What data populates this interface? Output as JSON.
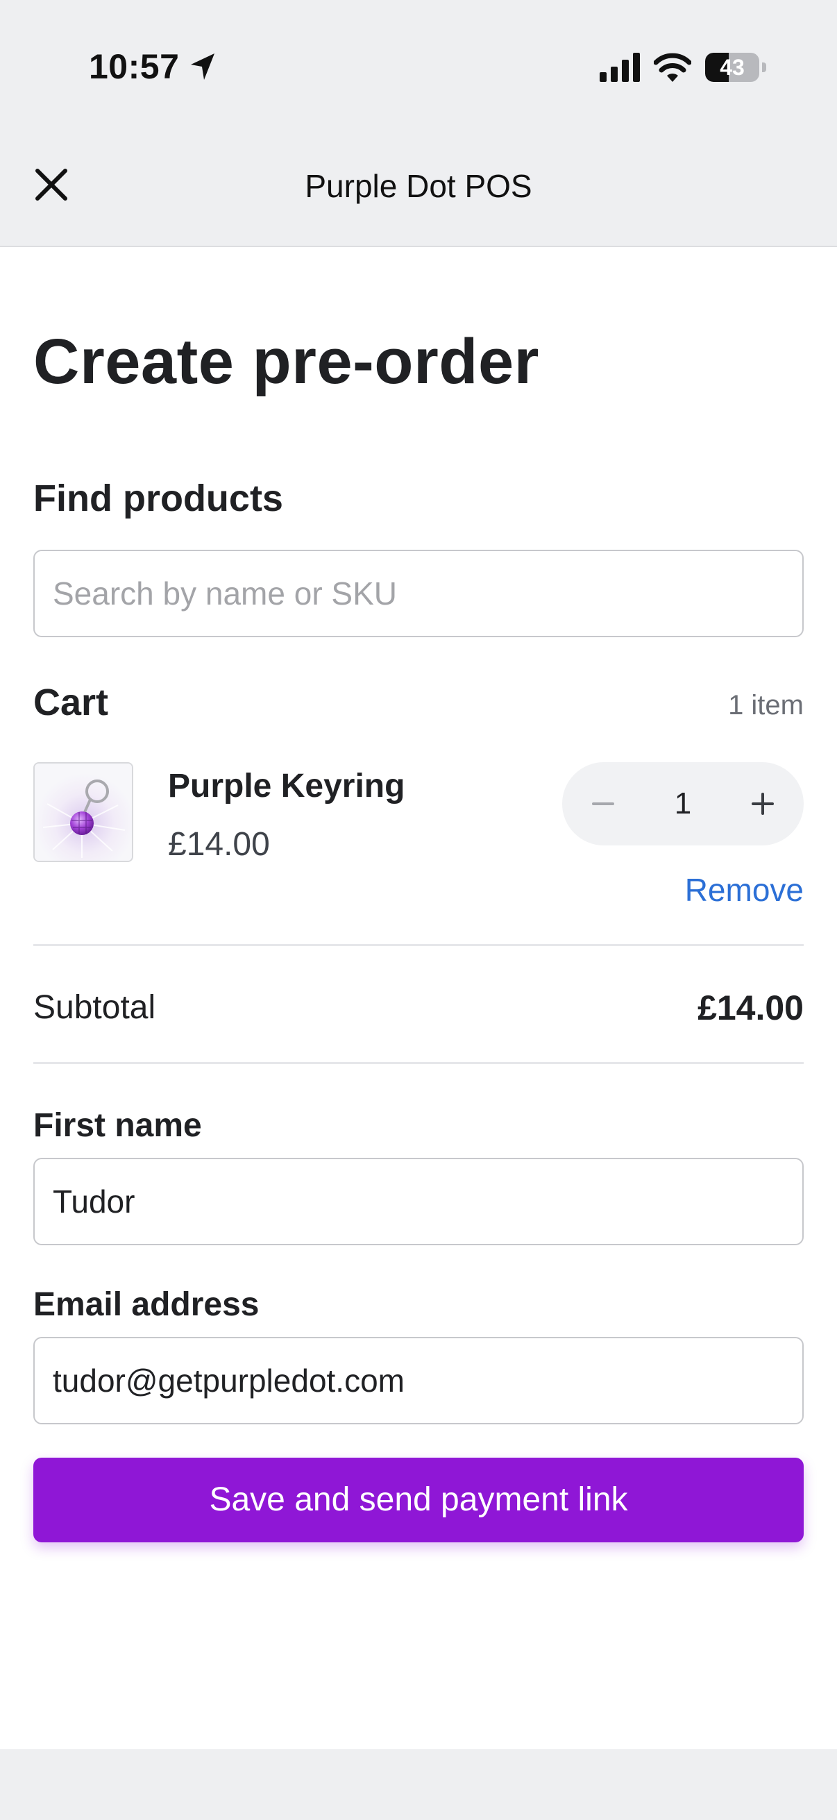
{
  "status_bar": {
    "time": "10:57",
    "battery_level": "43",
    "battery_fraction": 0.43,
    "icons": [
      "location-arrow-icon",
      "cellular-signal-icon",
      "wifi-icon",
      "battery-icon"
    ]
  },
  "header": {
    "title": "Purple Dot POS",
    "close_icon": "close-icon"
  },
  "page": {
    "title": "Create pre-order"
  },
  "find_products": {
    "heading": "Find products",
    "search_placeholder": "Search by name or SKU",
    "search_value": ""
  },
  "cart": {
    "heading": "Cart",
    "count_label": "1 item",
    "items": [
      {
        "name": "Purple Keyring",
        "price": "£14.00",
        "quantity": "1",
        "remove_label": "Remove",
        "image_icon": "keyring-product-image"
      }
    ],
    "subtotal_label": "Subtotal",
    "subtotal_value": "£14.00"
  },
  "form": {
    "first_name_label": "First name",
    "first_name_value": "Tudor",
    "email_label": "Email address",
    "email_value": "tudor@getpurpledot.com",
    "submit_label": "Save and send payment link"
  },
  "colors": {
    "primary": "#8f17d6",
    "link": "#2b6fd6",
    "chrome_background": "#eeeff1",
    "text": "#202124"
  }
}
